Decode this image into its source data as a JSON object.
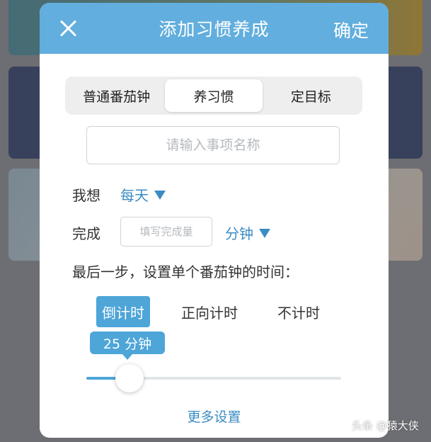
{
  "header": {
    "title": "添加习惯养成",
    "confirm_label": "确定"
  },
  "tabs": [
    {
      "label": "普通番茄钟",
      "active": false
    },
    {
      "label": "养习惯",
      "active": true
    },
    {
      "label": "定目标",
      "active": false
    }
  ],
  "name_input": {
    "placeholder": "请输入事项名称",
    "value": ""
  },
  "frequency": {
    "label": "我想",
    "value": "每天"
  },
  "amount": {
    "label": "完成",
    "placeholder": "填写完成量",
    "value": "",
    "unit": "分钟"
  },
  "instruction": "最后一步，设置单个番茄钟的时间：",
  "timer_modes": [
    {
      "label": "倒计时",
      "active": true
    },
    {
      "label": "正向计时",
      "active": false
    },
    {
      "label": "不计时",
      "active": false
    }
  ],
  "slider": {
    "value_label": "25 分钟",
    "value": 25,
    "fraction": 0.17
  },
  "more_settings": "更多设置",
  "watermark": "头条 @猿大侠",
  "colors": {
    "accent": "#4da5d8",
    "header": "#62aede",
    "link": "#3b8cc4"
  }
}
